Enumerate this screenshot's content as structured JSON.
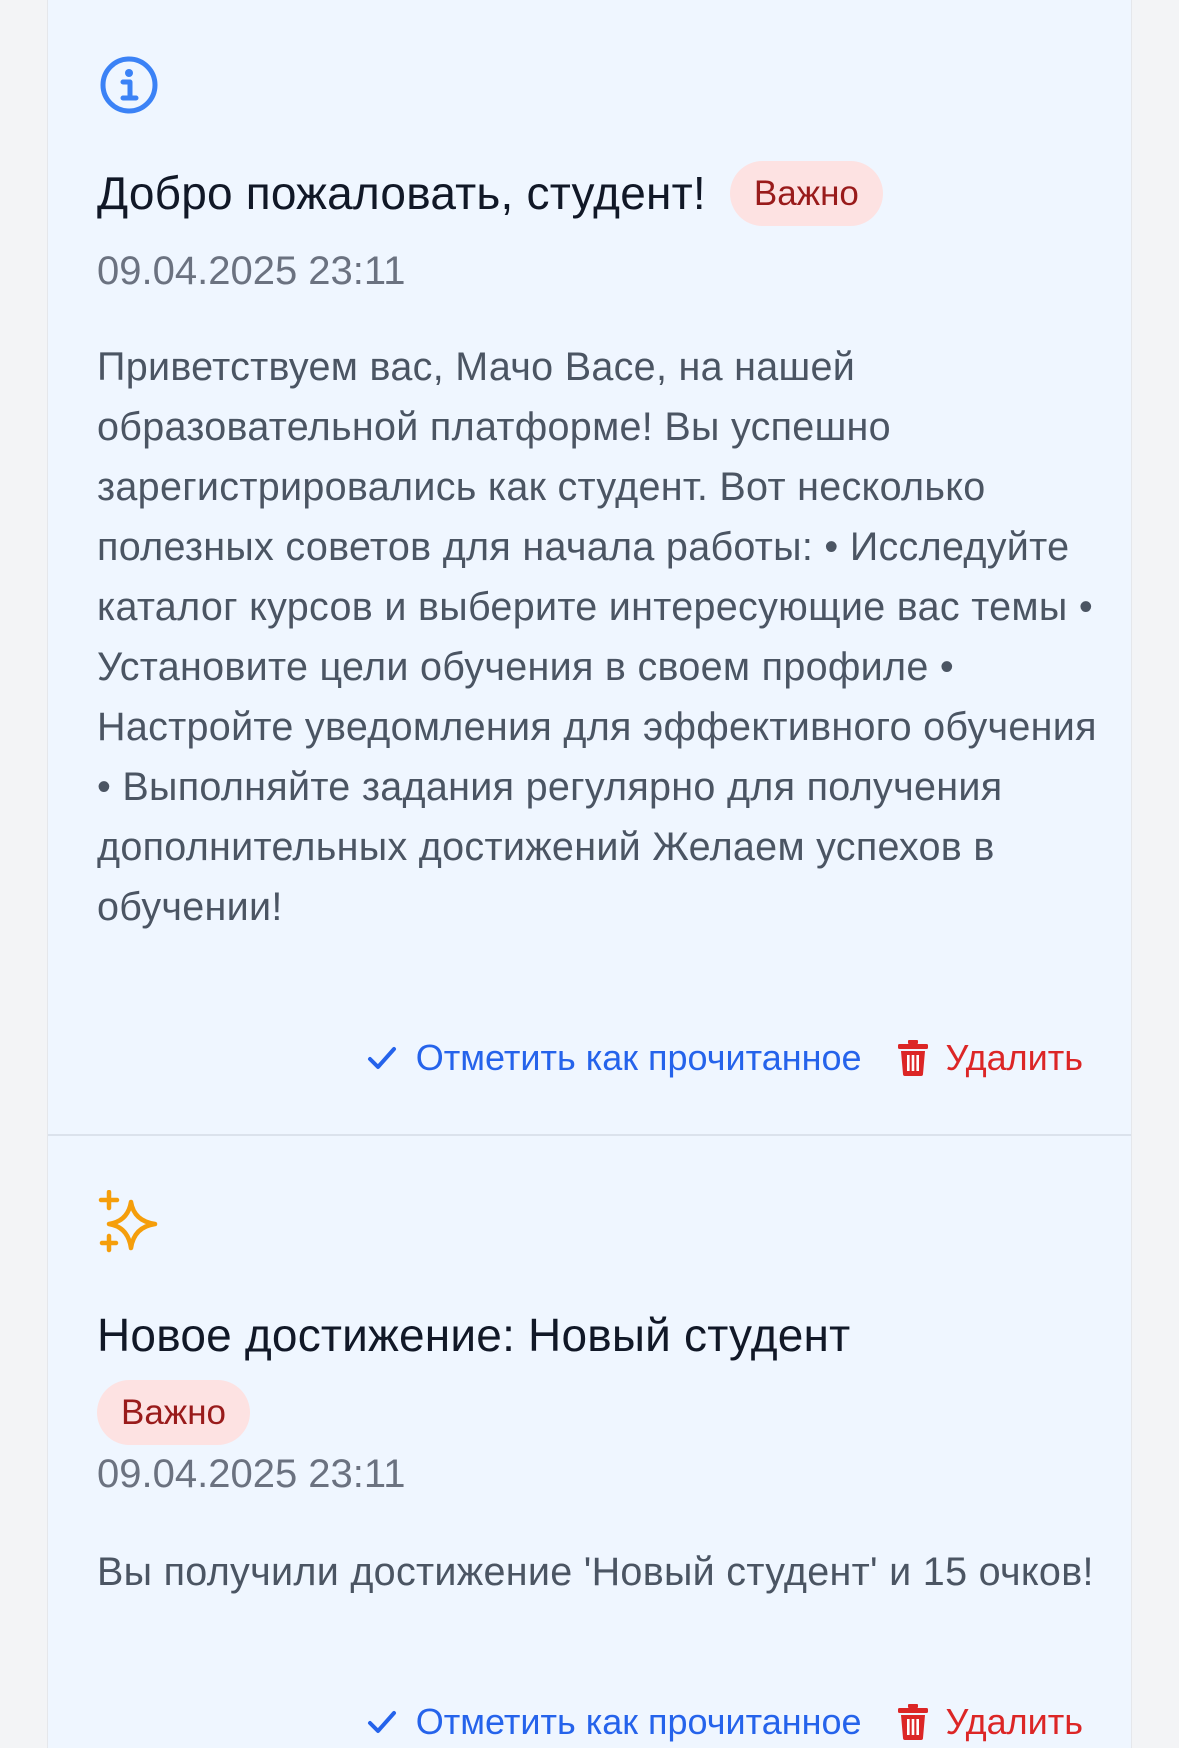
{
  "notifications": [
    {
      "icon": "info-icon",
      "title": "Добро пожаловать, студент!",
      "badge": "Важно",
      "date": "09.04.2025 23:11",
      "body": "Приветствуем вас, Мачо Васе, на нашей образовательной платформе! Вы успешно зарегистрировались как студент. Вот несколько полезных советов для начала работы: • Исследуйте каталог курсов и выберите интересующие вас темы • Установите цели обучения в своем профиле • Настройте уведомления для эффективного обучения • Выполняйте задания регулярно для получения дополнительных достижений Желаем успехов в обучении!",
      "mark_read_label": "Отметить как прочитанное",
      "delete_label": "Удалить"
    },
    {
      "icon": "sparkles-icon",
      "title": "Новое достижение: Новый студент",
      "badge": "Важно",
      "date": "09.04.2025 23:11",
      "body": "Вы получили достижение 'Новый студент' и 15 очков!",
      "mark_read_label": "Отметить как прочитанное",
      "delete_label": "Удалить"
    }
  ],
  "colors": {
    "card_background": "#eff6ff",
    "info_icon": "#3b82f6",
    "sparkles_icon": "#f59e0b",
    "badge_background": "#fde2e2",
    "badge_text": "#991b1b",
    "mark_read": "#2563eb",
    "delete": "#dc2626"
  }
}
